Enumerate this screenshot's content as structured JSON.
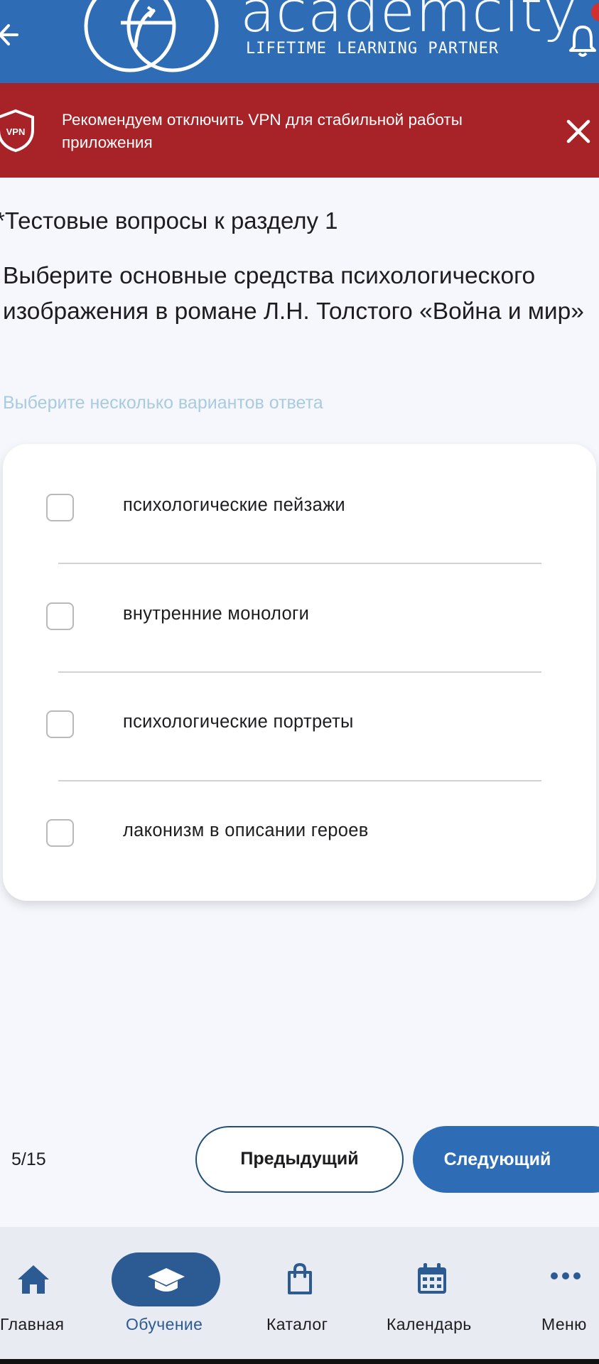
{
  "header": {
    "brand_name": "academcity",
    "brand_tagline": "LIFETIME LEARNING PARTNER"
  },
  "banner": {
    "icon_text": "VPN",
    "message": "Рекомендуем отключить VPN для стабильной работы приложения"
  },
  "question": {
    "section_title": "*Тестовые вопросы к разделу 1",
    "text": "Выберите основные средства психологического изображения в романе Л.Н. Толстого «Война и мир»",
    "hint": "Выберите несколько вариантов ответа",
    "options": [
      {
        "label": "психологические пейзажи",
        "checked": false
      },
      {
        "label": "внутренние монологи",
        "checked": false
      },
      {
        "label": "психологические портреты",
        "checked": false
      },
      {
        "label": "лаконизм в описании героев",
        "checked": false
      }
    ]
  },
  "pagination": {
    "counter": "5/15",
    "prev_label": "Предыдущий",
    "next_label": "Следующий"
  },
  "bottom_nav": {
    "items": [
      {
        "label": "Главная",
        "icon": "home-icon"
      },
      {
        "label": "Обучение",
        "icon": "graduation-cap-icon",
        "active": true
      },
      {
        "label": "Каталог",
        "icon": "shopping-bag-icon"
      },
      {
        "label": "Календарь",
        "icon": "calendar-icon"
      },
      {
        "label": "Меню",
        "icon": "more-dots-icon"
      }
    ]
  },
  "colors": {
    "header_bg": "#2e6db5",
    "banner_bg": "#a72328",
    "accent_active": "#2b5b92",
    "hint_text": "#a9cbe0"
  }
}
